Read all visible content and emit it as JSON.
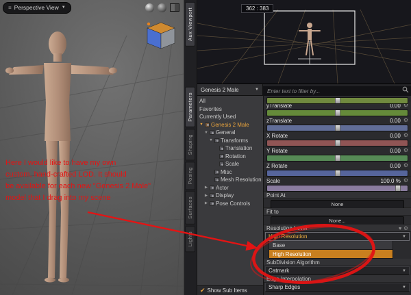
{
  "colors": {
    "annotation_red": "#e31414",
    "accent_orange": "#e8a33d",
    "highlight_orange": "#c87f1f"
  },
  "viewport": {
    "view_label": "Perspective View",
    "annotation_lines": [
      "Here I would like to have my own",
      "custom, hand-crafted LOD. It should",
      "be available for each new \"Genesis 2 Male\"",
      "model that I drag into my scene"
    ]
  },
  "aux": {
    "coords": "362 : 383"
  },
  "side_tabs": {
    "top": [
      {
        "label": "Aux Viewport",
        "active": true
      }
    ],
    "bottom": [
      {
        "label": "Parameters",
        "active": true
      },
      {
        "label": "Shaping",
        "active": false
      },
      {
        "label": "Posing",
        "active": false
      },
      {
        "label": "Surfaces",
        "active": false
      },
      {
        "label": "Lights",
        "active": false
      }
    ]
  },
  "parameters": {
    "scope": "Genesis 2 Male",
    "filter_placeholder": "Enter text to filter by...",
    "show_sub_items": "Show Sub Items",
    "nav": [
      {
        "label": "All",
        "depth": 0,
        "type": "plain"
      },
      {
        "label": "Favorites",
        "depth": 0,
        "type": "plain"
      },
      {
        "label": "Currently Used",
        "depth": 0,
        "type": "plain"
      },
      {
        "label": "Genesis 2 Male",
        "depth": 0,
        "type": "root",
        "selected": true
      },
      {
        "label": "General",
        "depth": 1,
        "type": "open"
      },
      {
        "label": "Transforms",
        "depth": 2,
        "type": "open"
      },
      {
        "label": "Translation",
        "depth": 3,
        "type": "leaf"
      },
      {
        "label": "Rotation",
        "depth": 3,
        "type": "leaf"
      },
      {
        "label": "Scale",
        "depth": 3,
        "type": "leaf"
      },
      {
        "label": "Misc",
        "depth": 2,
        "type": "leaf"
      },
      {
        "label": "Mesh Resolution",
        "depth": 2,
        "type": "leaf"
      },
      {
        "label": "Actor",
        "depth": 1,
        "type": "closed"
      },
      {
        "label": "Display",
        "depth": 1,
        "type": "closed"
      },
      {
        "label": "Pose Controls",
        "depth": 1,
        "type": "closed"
      }
    ],
    "rows": [
      {
        "kind": "slider",
        "label": "",
        "value": "",
        "color": "#7d9a44",
        "pos": 0.5,
        "clip": true
      },
      {
        "kind": "slider",
        "label": "yTranslate",
        "value": "0.00",
        "color": "#6f9a3f",
        "pos": 0.5
      },
      {
        "kind": "slider",
        "label": "zTranslate",
        "value": "0.00",
        "color": "#6b79a8",
        "pos": 0.5
      },
      {
        "kind": "slider",
        "label": "X Rotate",
        "value": "0.00",
        "color": "#a05d5d",
        "pos": 0.5
      },
      {
        "kind": "slider",
        "label": "Y Rotate",
        "value": "0.00",
        "color": "#5f9a5f",
        "pos": 0.5
      },
      {
        "kind": "slider",
        "label": "Z Rotate",
        "value": "0.00",
        "color": "#5f6fae",
        "pos": 0.5
      },
      {
        "kind": "slider",
        "label": "Scale",
        "value": "100.0 %",
        "color": "#9a8ab2",
        "pos": 0.93
      },
      {
        "kind": "label",
        "label": "Point At"
      },
      {
        "kind": "button",
        "label": "None"
      },
      {
        "kind": "label",
        "label": "Fit to"
      },
      {
        "kind": "button",
        "label": "None..."
      },
      {
        "kind": "label",
        "label": "Resolution Level",
        "icons": true
      },
      {
        "kind": "select-open",
        "label": "High Resolution"
      },
      {
        "kind": "option",
        "label": "Base",
        "selected": false
      },
      {
        "kind": "option",
        "label": "High Resolution",
        "selected": true
      },
      {
        "kind": "label",
        "label": "SubDivision Algorithm"
      },
      {
        "kind": "select",
        "label": "Catmark"
      },
      {
        "kind": "label",
        "label": "Edge Interpolation"
      },
      {
        "kind": "select",
        "label": "Sharp Edges"
      }
    ]
  }
}
